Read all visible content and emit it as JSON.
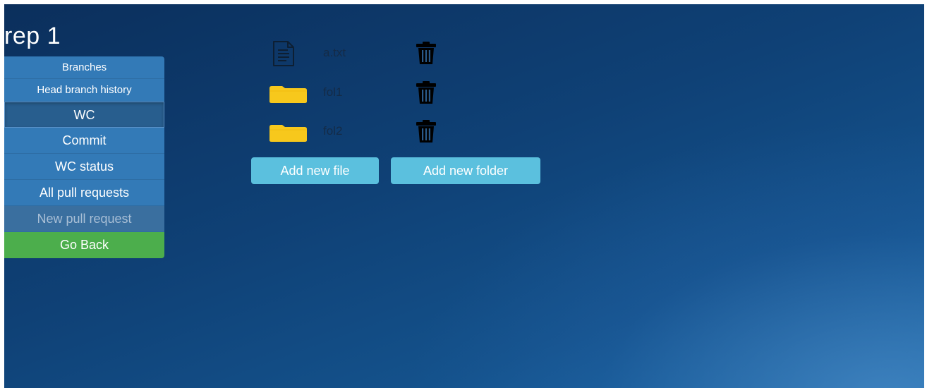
{
  "repo": {
    "title": "rep 1"
  },
  "sidebar": {
    "items": [
      {
        "label": "Branches"
      },
      {
        "label": "Head branch history"
      },
      {
        "label": "WC"
      },
      {
        "label": "Commit"
      },
      {
        "label": "WC status"
      },
      {
        "label": "All pull requests"
      },
      {
        "label": "New pull request"
      },
      {
        "label": "Go Back"
      }
    ]
  },
  "files": [
    {
      "name": "a.txt",
      "type": "file",
      "icon": "text-file-icon"
    },
    {
      "name": "fol1",
      "type": "folder",
      "icon": "folder-icon"
    },
    {
      "name": "fol2",
      "type": "folder",
      "icon": "folder-icon"
    }
  ],
  "actions": {
    "add_file_label": "Add new file",
    "add_folder_label": "Add new folder"
  },
  "colors": {
    "primary": "#337ab7",
    "success": "#4cae4c",
    "info": "#5bc0de",
    "folder": "#f5c518"
  }
}
